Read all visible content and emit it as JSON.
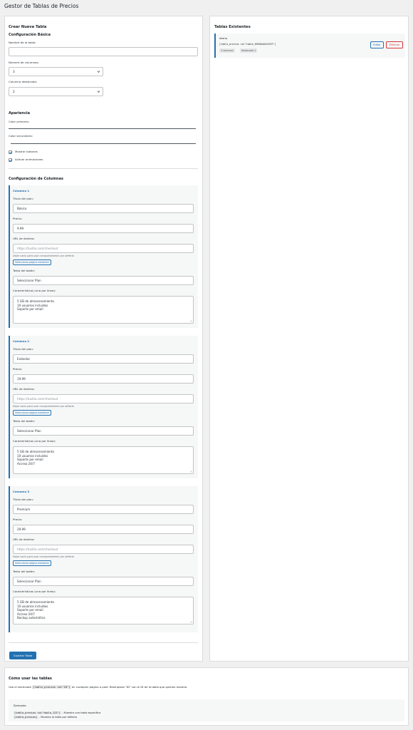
{
  "page_title": "Gestor de Tablas de Precios",
  "colors": {
    "accent": "#2271b1",
    "danger": "#d63638",
    "border": "#c3c4c7",
    "background": "#f0f0f1"
  },
  "form": {
    "title": "Crear Nueva Tabla",
    "basic": {
      "heading": "Configuración Básica",
      "name_label": "Nombre de la tabla:",
      "name_value": "",
      "num_cols_label": "Número de columnas:",
      "num_cols_value": "3",
      "featured_label": "Columna destacada:",
      "featured_value": "2"
    },
    "appearance": {
      "heading": "Apariencia",
      "primary_color_label": "Color primario:",
      "secondary_color_label": "Color secundario:",
      "show_buttons_label": "Mostrar botones",
      "show_buttons_checked": true,
      "animations_label": "Activar animaciones",
      "animations_checked": true
    },
    "columns_heading": "Configuración de Columnas",
    "field_labels": {
      "plan_title": "Título del plan:",
      "price": "Precio:",
      "url": "URL de destino:",
      "url_placeholder": "https://tusitio.com/checkout",
      "url_hint": "Dejar vacío para usar comportamiento por defecto",
      "select_page": "Seleccionar página existente",
      "button_text": "Texto del botón:",
      "features": "Características (una por línea):"
    },
    "columns": [
      {
        "title": "Columna 1",
        "plan": "Básico",
        "price": "9.99",
        "button": "Seleccionar Plan",
        "features": [
          "5 GB de almacenamiento",
          "10 usuarios incluidos",
          "Soporte por email"
        ]
      },
      {
        "title": "Columna 2",
        "plan": "Estándar",
        "price": "19.99",
        "button": "Seleccionar Plan",
        "features": [
          "5 GB de almacenamiento",
          "10 usuarios incluidos",
          "Soporte por email",
          "Acceso 24/7"
        ]
      },
      {
        "title": "Columna 3",
        "plan": "Premium",
        "price": "29.99",
        "button": "Seleccionar Plan",
        "features": [
          "5 GB de almacenamiento",
          "10 usuarios incluidos",
          "Soporte por email",
          "Acceso 24/7",
          "Backup automático"
        ]
      }
    ],
    "save_button": "Guardar Tabla"
  },
  "existing": {
    "title": "Tablas Existentes",
    "items": [
      {
        "name": "demo",
        "shortcode": "[tabla_precios id=\"tabla_699d2b48c529f\"]",
        "cols_tag": "3 columnas",
        "featured_tag": "Destacada: 2",
        "edit": "Editar",
        "delete": "Eliminar"
      }
    ]
  },
  "help": {
    "title": "Cómo usar las tablas",
    "intro_before": "Usa el shortcode",
    "intro_code": "[tabla_precios id=\"ID\"]",
    "intro_after": "en cualquier página o post. Reemplaza \"ID\" con el ID de la tabla que quieres mostrar.",
    "examples_label": "Ejemplos:",
    "ex1_code": "[tabla_precios id=\"tabla_123\"]",
    "ex1_text": "- Muestra una tabla específica",
    "ex2_code": "[tabla_precios]",
    "ex2_text": "- Muestra la tabla por defecto"
  }
}
